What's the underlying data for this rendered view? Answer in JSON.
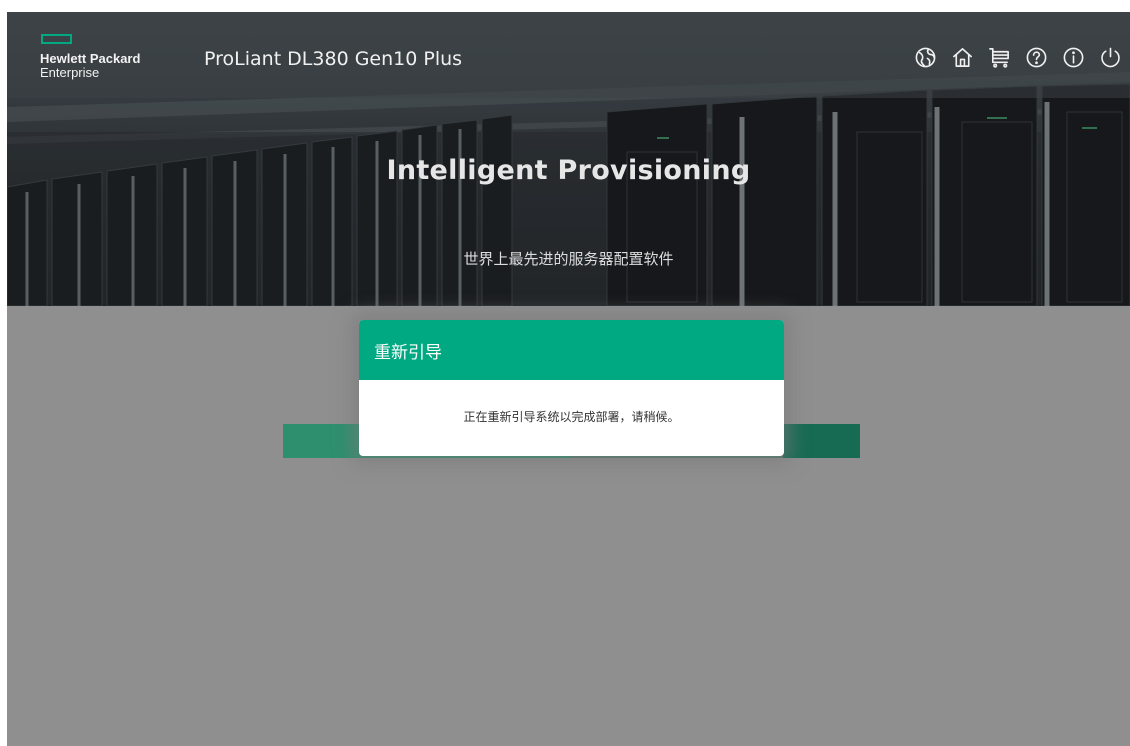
{
  "header": {
    "brand_line1": "Hewlett Packard",
    "brand_line2": "Enterprise",
    "product_title": "ProLiant DL380 Gen10 Plus",
    "toolbar": [
      {
        "name": "globe-icon"
      },
      {
        "name": "home-icon"
      },
      {
        "name": "cart-icon"
      },
      {
        "name": "help-icon"
      },
      {
        "name": "info-icon"
      },
      {
        "name": "power-icon"
      }
    ]
  },
  "hero": {
    "title": "Intelligent Provisioning",
    "subtitle": "世界上最先进的服务器配置软件"
  },
  "progress": {
    "fraction": 0.5
  },
  "dialog": {
    "title": "重新引导",
    "message": "正在重新引导系统以完成部署，请稍候。"
  },
  "colors": {
    "accent": "#01a982",
    "overlay": "#8f8f8f",
    "progress_track": "#4d7b6c",
    "progress_fill": "#2e8f6e"
  }
}
